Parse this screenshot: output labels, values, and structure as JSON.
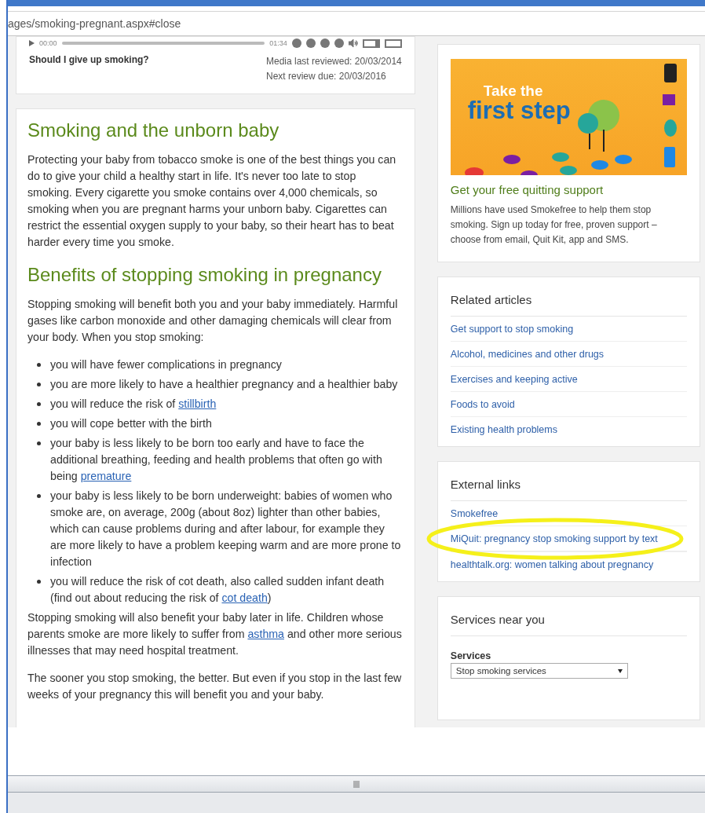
{
  "address_bar": {
    "url": "ages/smoking-pregnant.aspx#close"
  },
  "media": {
    "elapsed": "00:00",
    "duration": "01:34",
    "title": "Should I give up smoking?",
    "reviewed": "Media last reviewed: 20/03/2014",
    "next_review": "Next review due: 20/03/2016"
  },
  "article": [
    {
      "kind": "heading",
      "text": "Smoking and the unborn baby"
    },
    {
      "kind": "paragraph",
      "parts": [
        {
          "text": "Protecting your baby from tobacco smoke is one of the best things you can do to give your child a healthy start in life. It's never too late to stop smoking. Every cigarette you smoke contains over 4,000 chemicals, so smoking when you are pregnant harms your unborn baby. Cigarettes can restrict the essential oxygen supply to your baby, so their heart has to beat harder every time you smoke."
        }
      ]
    },
    {
      "kind": "heading",
      "text": "Benefits of stopping smoking in pregnancy"
    },
    {
      "kind": "paragraph",
      "parts": [
        {
          "text": "Stopping smoking will benefit both you and your baby immediately. Harmful gases like carbon monoxide and other damaging chemicals will clear from your body. When you stop smoking:"
        }
      ]
    },
    {
      "kind": "bullet",
      "parts": [
        {
          "text": "you will have fewer complications in pregnancy"
        }
      ]
    },
    {
      "kind": "bullet",
      "parts": [
        {
          "text": "you are more likely to have a healthier pregnancy and a healthier baby"
        }
      ]
    },
    {
      "kind": "bullet",
      "parts": [
        {
          "text": "you will reduce the risk of "
        },
        {
          "link": "stillbirth"
        }
      ]
    },
    {
      "kind": "bullet",
      "parts": [
        {
          "text": "you will cope better with the birth"
        }
      ]
    },
    {
      "kind": "bullet",
      "parts": [
        {
          "text": "your baby is less likely to be born too early and have to face the additional breathing, feeding and health problems that often go with being "
        },
        {
          "link": "premature"
        }
      ]
    },
    {
      "kind": "bullet",
      "parts": [
        {
          "text": "your baby is less likely to be born underweight: babies of women who smoke are, on average, 200g (about 8oz) lighter than other babies, which can cause problems during and after labour, for example they are more likely to have a problem keeping warm and are more prone to infection"
        }
      ]
    },
    {
      "kind": "bullet",
      "parts": [
        {
          "text": "you will reduce the risk of cot death, also called sudden infant death (find out about reducing the risk of "
        },
        {
          "link": "cot death"
        },
        {
          "text": ")"
        }
      ]
    },
    {
      "kind": "paragraph",
      "parts": [
        {
          "text": "Stopping smoking will also benefit your baby later in life. Children whose parents smoke are more likely to suffer from "
        },
        {
          "link": "asthma"
        },
        {
          "text": " and other more serious illnesses that may need hospital treatment."
        }
      ]
    },
    {
      "kind": "paragraph",
      "parts": [
        {
          "text": "The sooner you stop smoking, the better. But even if you stop in the last few weeks of your pregnancy this will benefit you and your baby."
        }
      ]
    }
  ],
  "promo": {
    "banner_line_1": "Take the",
    "banner_line_2": "first step",
    "title": "Get your free quitting support",
    "text": "Millions have used Smokefree to help them stop smoking. Sign up today for free, proven support – choose from email, Quit Kit, app and SMS."
  },
  "related_articles": {
    "title": "Related articles",
    "links": [
      "Get support to stop smoking",
      "Alcohol, medicines and other drugs",
      "Exercises and keeping active",
      "Foods to avoid",
      "Existing health problems"
    ]
  },
  "external_links": {
    "title": "External links",
    "links": [
      {
        "label": "Smokefree",
        "highlighted": false
      },
      {
        "label": "MiQuit: pregnancy stop smoking support by text",
        "highlighted": true
      },
      {
        "label": "healthtalk.org: women talking about pregnancy",
        "highlighted": false
      }
    ]
  },
  "services": {
    "title": "Services near you",
    "field_label": "Services",
    "value": "Stop smoking services"
  }
}
